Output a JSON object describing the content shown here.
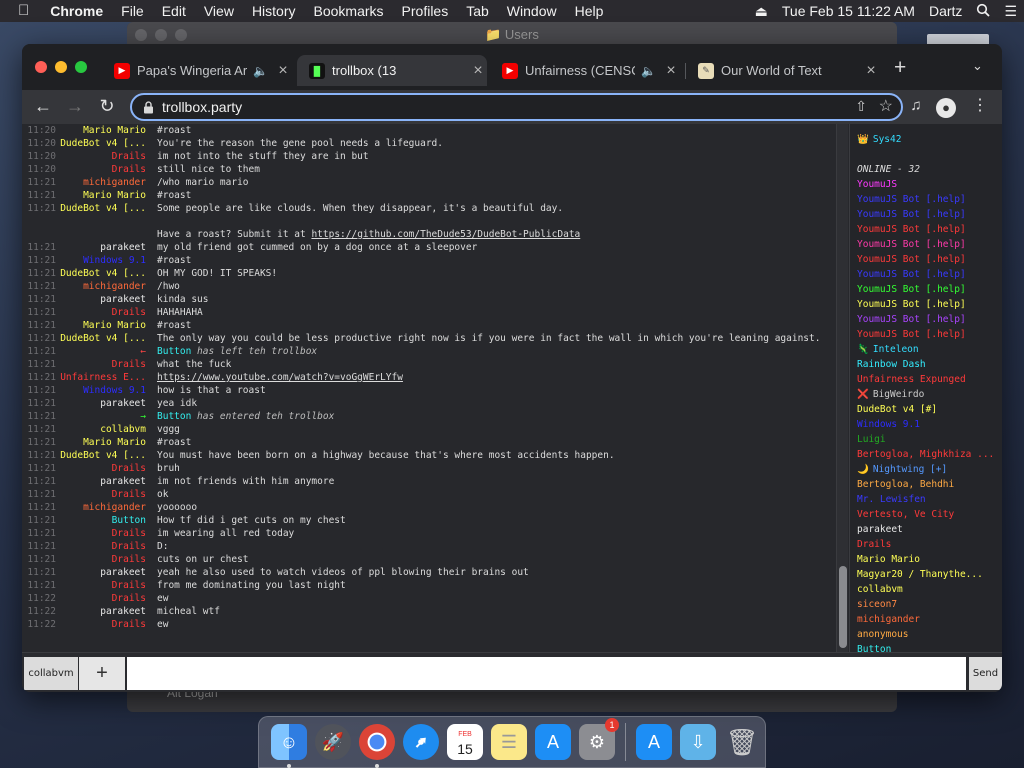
{
  "menubar": {
    "app": "Chrome",
    "items": [
      "File",
      "Edit",
      "View",
      "History",
      "Bookmarks",
      "Profiles",
      "Tab",
      "Window",
      "Help"
    ],
    "datetime": "Tue Feb 15  11:22 AM",
    "user": "Dartz"
  },
  "background_window": {
    "title": "Users",
    "footer": "Alt Logan"
  },
  "tabs": [
    {
      "title": "Papa's Wingeria Ar",
      "icon": "youtube-icon",
      "audio": true
    },
    {
      "title": "trollbox (13",
      "icon": "trollbox-favicon",
      "active": true
    },
    {
      "title": "Unfairness (CENSO",
      "icon": "youtube-icon",
      "audio": true
    },
    {
      "title": "Our World of Text",
      "icon": "owot-favicon"
    }
  ],
  "address_bar": {
    "url": "trollbox.party"
  },
  "chat": {
    "messages": [
      {
        "time": "11:20",
        "nick": "Mario Mario",
        "color": "#ffff55",
        "text": "#roast"
      },
      {
        "time": "11:20",
        "nick": "DudeBot v4 [...",
        "color": "#ffff55",
        "text": "You're the reason the gene pool needs a lifeguard."
      },
      {
        "time": "11:20",
        "nick": "Drails",
        "color": "#ff3a3a",
        "text": "im not into the stuff they are in but"
      },
      {
        "time": "11:20",
        "nick": "Drails",
        "color": "#ff3a3a",
        "text": "still nice to them"
      },
      {
        "time": "11:21",
        "nick": "michigander",
        "color": "#ff6a3a",
        "text": "/who mario mario"
      },
      {
        "time": "11:21",
        "nick": "Mario Mario",
        "color": "#ffff55",
        "text": "#roast"
      },
      {
        "time": "11:21",
        "nick": "DudeBot v4 [...",
        "color": "#ffff55",
        "text": "Some people are like clouds. When they disappear, it's a beautiful day.\n\nHave a roast? Submit it at ",
        "link": "https://github.com/TheDude53/DudeBot-PublicData"
      },
      {
        "time": "11:21",
        "nick": "parakeet",
        "color": "#e8e8e8",
        "text": "my old friend got cummed on by a dog once at a sleepover"
      },
      {
        "time": "11:21",
        "nick": "Windows 9.1",
        "color": "#2d2dff",
        "text": "#roast"
      },
      {
        "time": "11:21",
        "nick": "DudeBot v4 [...",
        "color": "#ffff55",
        "text": "OH MY GOD! IT SPEAKS!"
      },
      {
        "time": "11:21",
        "nick": "michigander",
        "color": "#ff6a3a",
        "text": "/hwo"
      },
      {
        "time": "11:21",
        "nick": "parakeet",
        "color": "#e8e8e8",
        "text": "kinda sus"
      },
      {
        "time": "11:21",
        "nick": "Drails",
        "color": "#ff3a3a",
        "text": "HAHAHAHA"
      },
      {
        "time": "11:21",
        "nick": "Mario Mario",
        "color": "#ffff55",
        "text": "#roast"
      },
      {
        "time": "11:21",
        "nick": "DudeBot v4 [...",
        "color": "#ffff55",
        "text": "The only way you could be less productive right now is if you were in fact the wall in which you're leaning against."
      },
      {
        "time": "11:21",
        "nick": "←",
        "color": "#ff4444",
        "sys": true,
        "who": "Button",
        "whocolor": "#33eeee",
        "text": " has left teh trollbox"
      },
      {
        "time": "11:21",
        "nick": "Drails",
        "color": "#ff3a3a",
        "text": "what the fuck"
      },
      {
        "time": "11:21",
        "nick": "Unfairness E...",
        "color": "#ff3a3a",
        "text": "",
        "link": "https://www.youtube.com/watch?v=voGgWErLYfw"
      },
      {
        "time": "11:21",
        "nick": "Windows 9.1",
        "color": "#2d2dff",
        "text": "how is that a roast"
      },
      {
        "time": "11:21",
        "nick": "parakeet",
        "color": "#e8e8e8",
        "text": "yea idk"
      },
      {
        "time": "11:21",
        "nick": "→",
        "color": "#33ff33",
        "sys": true,
        "who": "Button",
        "whocolor": "#33eeee",
        "text": " has entered teh trollbox"
      },
      {
        "time": "11:21",
        "nick": "collabvm",
        "color": "#ffff55",
        "text": "vggg"
      },
      {
        "time": "11:21",
        "nick": "Mario Mario",
        "color": "#ffff55",
        "text": "#roast"
      },
      {
        "time": "11:21",
        "nick": "DudeBot v4 [...",
        "color": "#ffff55",
        "text": "You must have been born on a highway because that's where most accidents happen."
      },
      {
        "time": "11:21",
        "nick": "Drails",
        "color": "#ff3a3a",
        "text": "bruh"
      },
      {
        "time": "11:21",
        "nick": "parakeet",
        "color": "#e8e8e8",
        "text": "im not friends with him anymore"
      },
      {
        "time": "11:21",
        "nick": "Drails",
        "color": "#ff3a3a",
        "text": "ok"
      },
      {
        "time": "11:21",
        "nick": "michigander",
        "color": "#ff6a3a",
        "text": "yoooooo"
      },
      {
        "time": "11:21",
        "nick": "Button",
        "color": "#33eeee",
        "text": "How tf did i get cuts on my chest"
      },
      {
        "time": "11:21",
        "nick": "Drails",
        "color": "#ff3a3a",
        "text": "im wearing all red today"
      },
      {
        "time": "11:21",
        "nick": "Drails",
        "color": "#ff3a3a",
        "text": "D:"
      },
      {
        "time": "11:21",
        "nick": "Drails",
        "color": "#ff3a3a",
        "text": "cuts on ur chest"
      },
      {
        "time": "11:21",
        "nick": "parakeet",
        "color": "#e8e8e8",
        "text": "yeah he also used to watch videos of ppl blowing their brains out"
      },
      {
        "time": "11:21",
        "nick": "Drails",
        "color": "#ff3a3a",
        "text": "from me dominating you last night"
      },
      {
        "time": "11:22",
        "nick": "Drails",
        "color": "#ff3a3a",
        "text": "ew"
      },
      {
        "time": "11:22",
        "nick": "parakeet",
        "color": "#e8e8e8",
        "text": "micheal wtf"
      },
      {
        "time": "11:22",
        "nick": "Drails",
        "color": "#ff3a3a",
        "text": "ew"
      }
    ]
  },
  "users_panel": {
    "users": [
      {
        "name": "Sys42",
        "color": "#33ddff",
        "icon": "👑"
      },
      {
        "name": ""
      },
      {
        "name": "ONLINE - 32",
        "color": "#dddddd",
        "header": true
      },
      {
        "name": "YoumuJS",
        "color": "#ff3aff"
      },
      {
        "name": "YoumuJS Bot [.help]",
        "color": "#3a3aff"
      },
      {
        "name": "YoumuJS Bot [.help]",
        "color": "#3a3aff"
      },
      {
        "name": "YoumuJS Bot [.help]",
        "color": "#ff3a3a"
      },
      {
        "name": "YoumuJS Bot [.help]",
        "color": "#ff3aaa"
      },
      {
        "name": "YoumuJS Bot [.help]",
        "color": "#ff3a3a"
      },
      {
        "name": "YoumuJS Bot [.help]",
        "color": "#3a3aff"
      },
      {
        "name": "YoumuJS Bot [.help]",
        "color": "#33ff33"
      },
      {
        "name": "YoumuJS Bot [.help]",
        "color": "#ffff55"
      },
      {
        "name": "YoumuJS Bot [.help]",
        "color": "#aa44ff"
      },
      {
        "name": "YoumuJS Bot [.help]",
        "color": "#ff3a3a"
      },
      {
        "name": "Inteleon",
        "color": "#33ddff",
        "icon": "🦎"
      },
      {
        "name": "Rainbow Dash",
        "color": "#33eeff"
      },
      {
        "name": "Unfairness Expunged",
        "color": "#ff3a3a"
      },
      {
        "name": "BigWeirdo",
        "color": "#cccccc",
        "icon": "❌"
      },
      {
        "name": "DudeBot v4 [#]",
        "color": "#ffff55"
      },
      {
        "name": "Windows 9.1",
        "color": "#2d2dff"
      },
      {
        "name": "Luigi",
        "color": "#22aa22"
      },
      {
        "name": "Bertogloa, Mighkhiza ...",
        "color": "#ff3a3a"
      },
      {
        "name": "Nightwing [+]",
        "color": "#5599ff",
        "icon": "🌙"
      },
      {
        "name": "Bertogloa, Behdhi",
        "color": "#ffaa44"
      },
      {
        "name": "Mr. Lewisfen",
        "color": "#3a3aff"
      },
      {
        "name": "Vertesto, Ve City",
        "color": "#ff3a3a"
      },
      {
        "name": "parakeet",
        "color": "#e8e8e8"
      },
      {
        "name": "Drails",
        "color": "#ff3a3a"
      },
      {
        "name": "Mario Mario",
        "color": "#ffff55"
      },
      {
        "name": "Magyar20 / Thanythe...",
        "color": "#ffff55"
      },
      {
        "name": "collabvm",
        "color": "#ffff55"
      },
      {
        "name": "siceon7",
        "color": "#ff8844"
      },
      {
        "name": "michigander",
        "color": "#ff6a3a"
      },
      {
        "name": "anonymous",
        "color": "#ffaa44"
      },
      {
        "name": "Button",
        "color": "#33eeee"
      }
    ]
  },
  "input_bar": {
    "room": "collabvm",
    "add": "+",
    "placeholder": "",
    "send": "Send"
  },
  "dock": {
    "calendar_month": "FEB",
    "calendar_day": "15",
    "badge": "1"
  }
}
